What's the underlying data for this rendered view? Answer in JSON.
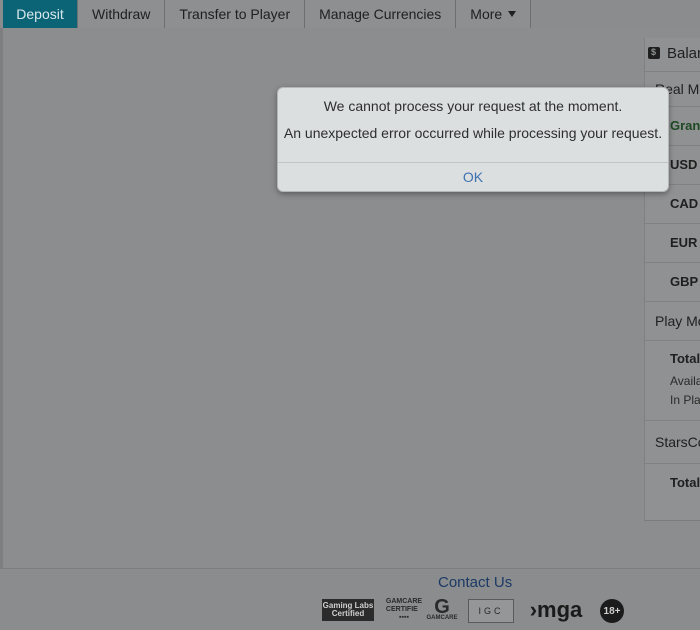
{
  "nav": {
    "tabs": [
      "Deposit",
      "Withdraw",
      "Transfer to Player",
      "Manage Currencies",
      "More"
    ]
  },
  "balance": {
    "title": "Balan",
    "real_money": "Real Mo",
    "grand": "Grand",
    "currencies": [
      "USD",
      "CAD",
      "EUR",
      "GBP"
    ],
    "play_money": "Play Mo",
    "play_total": "Total",
    "available": "Availa",
    "in_play": "In Pla",
    "stars_coin": "StarsCo",
    "stars_total": "Total"
  },
  "footer": {
    "contact": "Contact Us",
    "logos": {
      "gaming_labs": "Gaming Labs Certified",
      "gamcare": "GAMCARE CERTIFIE",
      "gamcare_g": "G",
      "gamcare_g_sub": "GAMCARE",
      "igc": "IGC",
      "mga": "mga",
      "age": "18+"
    }
  },
  "dialog": {
    "line1": "We cannot process your request at the moment.",
    "line2": "An unexpected error occurred while processing your request.",
    "ok": "OK"
  },
  "colors": {
    "active_tab": "#0b6476",
    "ok_link": "#3f72b0",
    "contact_link": "#1c3a66"
  }
}
